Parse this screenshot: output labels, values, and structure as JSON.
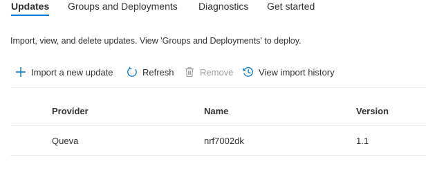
{
  "tabs": [
    {
      "label": "Updates",
      "active": true
    },
    {
      "label": "Groups and Deployments",
      "active": false
    },
    {
      "label": "Diagnostics",
      "active": false
    },
    {
      "label": "Get started",
      "active": false
    }
  ],
  "description": "Import, view, and delete updates. View 'Groups and Deployments' to deploy.",
  "toolbar": {
    "import_label": "Import a new update",
    "refresh_label": "Refresh",
    "remove_label": "Remove",
    "history_label": "View import history"
  },
  "table": {
    "columns": [
      "Provider",
      "Name",
      "Version"
    ],
    "rows": [
      {
        "provider": "Queva",
        "name": "nrf7002dk",
        "version": "1.1"
      }
    ]
  },
  "colors": {
    "accent": "#0078d4",
    "text": "#323130",
    "disabled": "#a19f9d",
    "divider": "#edebe9"
  },
  "icons": {
    "import": "plus-icon",
    "refresh": "refresh-icon",
    "remove": "trash-icon",
    "history": "history-icon"
  }
}
